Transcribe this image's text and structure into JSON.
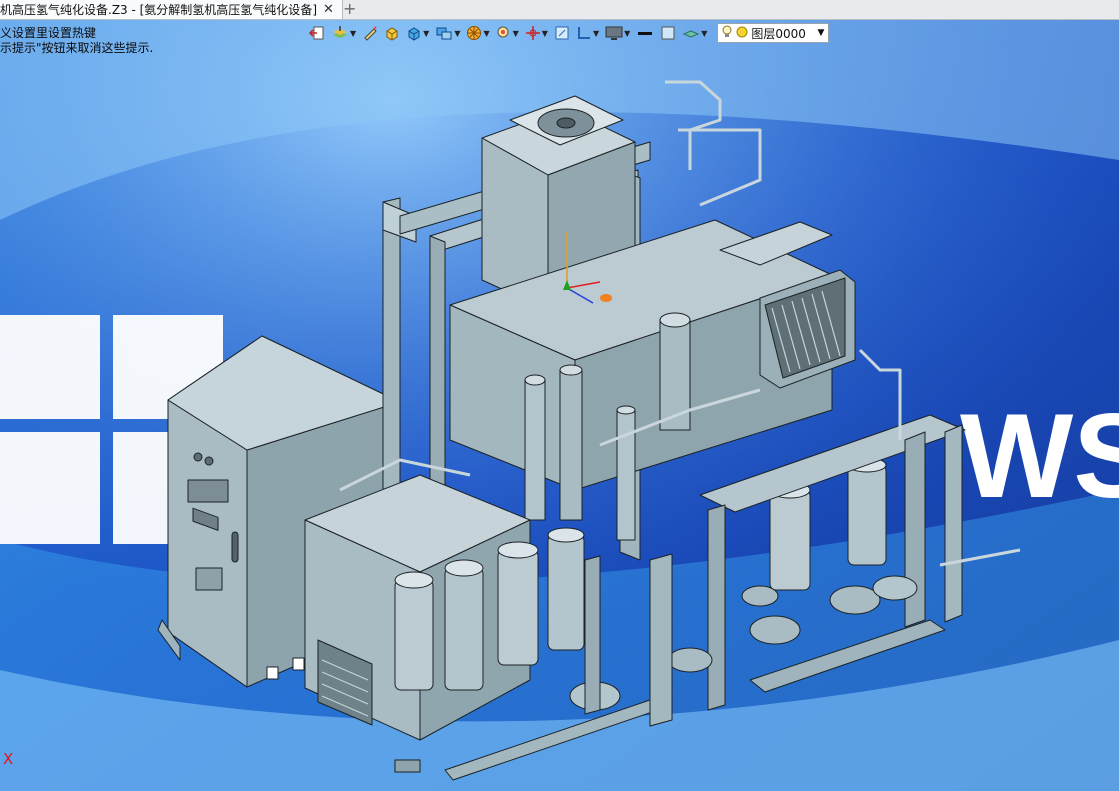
{
  "tab": {
    "title": "机高压氢气纯化设备.Z3 - [氨分解制氢机高压氢气纯化设备]",
    "close_icon": "close-icon",
    "add_icon": "plus-icon"
  },
  "hints": {
    "line1": "义设置里设置热键",
    "line2": "示提示\"按钮来取消这些提示."
  },
  "toolbar": {
    "tools": [
      "exit-icon",
      "layer-manager-icon",
      "sketch-icon",
      "solid-icon",
      "cube-view-icon",
      "display-mode-icon",
      "render-icon",
      "zoom-icon",
      "axis-icon",
      "plane-icon",
      "dimension-icon",
      "monitor-icon",
      "line-color-icon",
      "face-color-icon",
      "layer-filter-icon"
    ],
    "layer_combo": "图层0000"
  },
  "viewport": {
    "axis_label": "X"
  },
  "colors": {
    "wall": "#1d5ec8",
    "model": "#a9bcc4",
    "model_dark": "#7d939c",
    "outline": "#1b2225"
  }
}
